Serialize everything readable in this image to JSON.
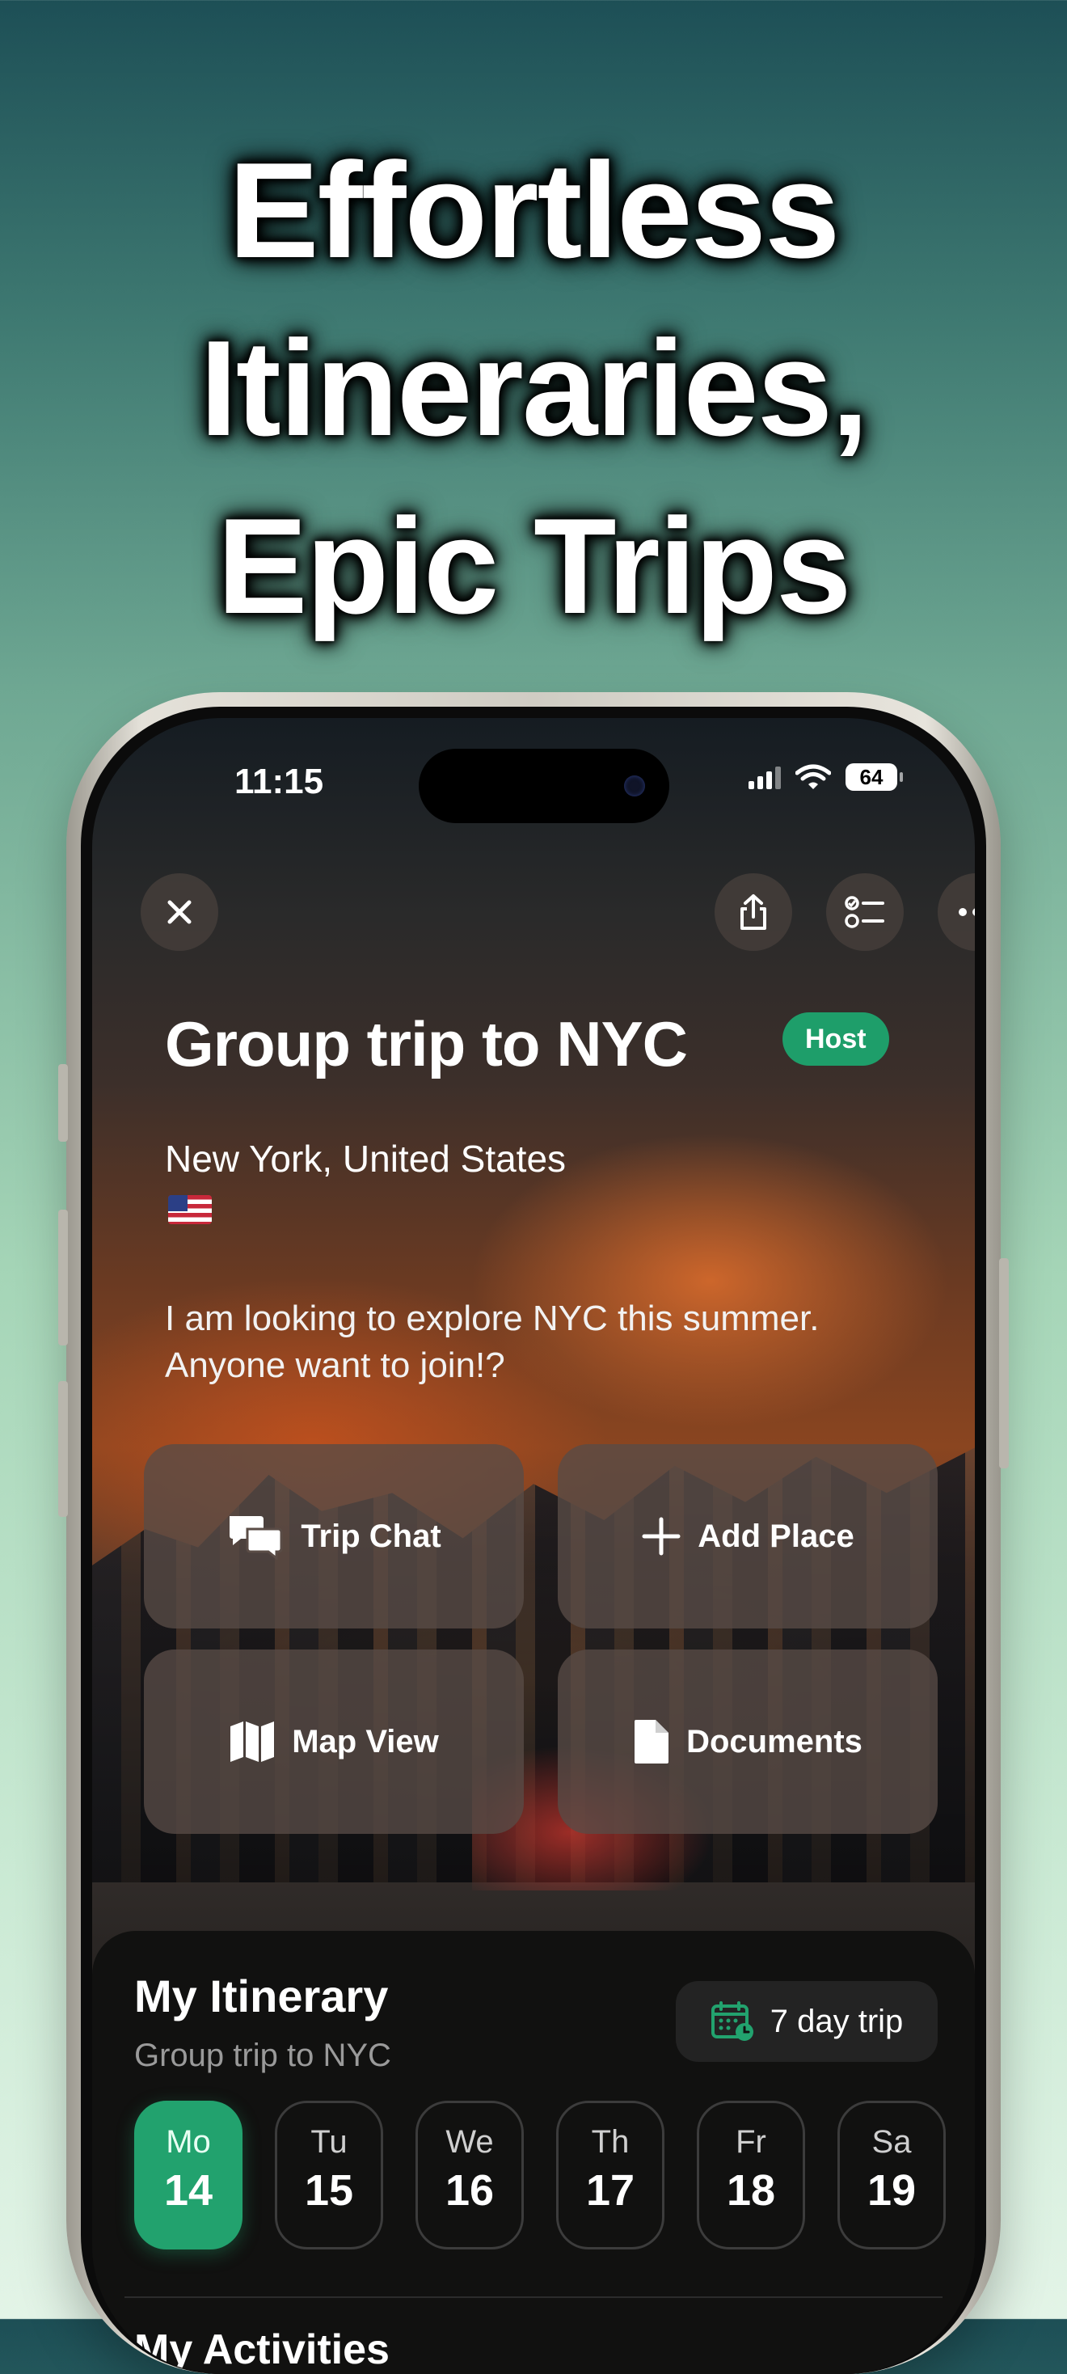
{
  "headline": {
    "lines": [
      "Effortless",
      "Itineraries,",
      "Epic Trips"
    ]
  },
  "status_bar": {
    "time": "11:15",
    "battery": "64"
  },
  "toolbar": {
    "close_icon": "close-icon",
    "share_icon": "share-icon",
    "checklist_icon": "checklist-icon",
    "more_icon": "more-icon"
  },
  "trip": {
    "title": "Group trip to NYC",
    "role_badge": "Host",
    "location": "New York, United States",
    "flag": "us-flag",
    "description": "I am looking to explore NYC this summer. Anyone want to join!?"
  },
  "actions": [
    {
      "label": "Trip Chat",
      "icon": "chat-bubbles-icon"
    },
    {
      "label": "Add Place",
      "icon": "plus-icon"
    },
    {
      "label": "Map View",
      "icon": "map-icon"
    },
    {
      "label": "Documents",
      "icon": "document-icon"
    }
  ],
  "itinerary": {
    "title": "My Itinerary",
    "subtitle": "Group trip to NYC",
    "trip_length": "7 day trip",
    "days": [
      {
        "dow": "Mo",
        "num": "14",
        "selected": true
      },
      {
        "dow": "Tu",
        "num": "15",
        "selected": false
      },
      {
        "dow": "We",
        "num": "16",
        "selected": false
      },
      {
        "dow": "Th",
        "num": "17",
        "selected": false
      },
      {
        "dow": "Fr",
        "num": "18",
        "selected": false
      },
      {
        "dow": "Sa",
        "num": "19",
        "selected": false
      }
    ],
    "next_section_title": "My Activities"
  },
  "colors": {
    "accent": "#22a26e",
    "badge": "#1e9e6a",
    "sheet": "#111110"
  }
}
